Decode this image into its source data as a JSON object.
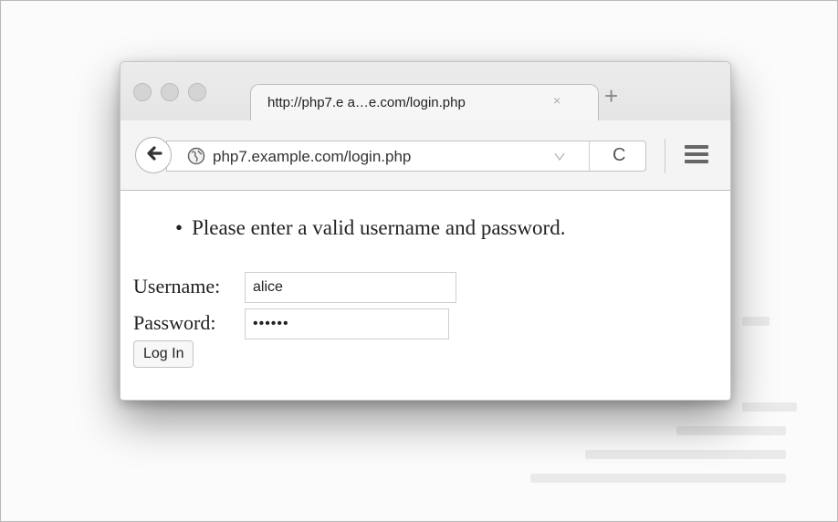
{
  "browser": {
    "tab_title": "http://php7.e  a…e.com/login.php",
    "tab_close": "×",
    "new_tab": "+",
    "url": "php7.example.com/login.php",
    "reload_glyph": "C"
  },
  "page": {
    "errors": [
      "Please enter a valid username and password."
    ],
    "username_label": "Username:",
    "username_value": "alice",
    "password_label": "Password:",
    "password_value": "••••••",
    "login_button": "Log In"
  },
  "icons": {
    "back": "back-arrow-icon",
    "site": "globe-icon",
    "bookmark": "chevron-down-icon",
    "reload": "reload-icon",
    "menu": "hamburger-menu-icon"
  }
}
